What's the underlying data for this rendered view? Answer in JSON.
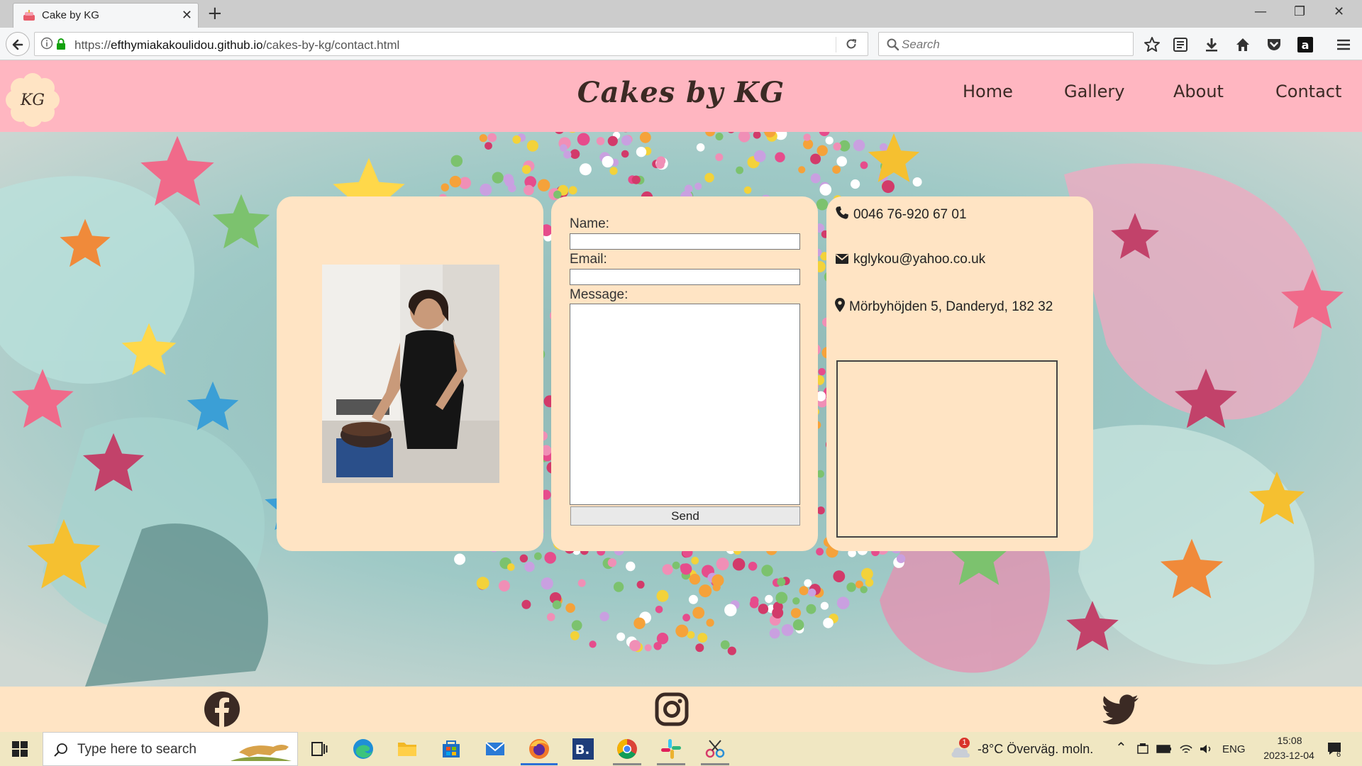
{
  "browser": {
    "tab_title": "Cake by KG",
    "new_tab": "+",
    "url_prefix": "https://",
    "url_host": "efthymiakakoulidou.github.io",
    "url_path": "/cakes-by-kg/contact.html",
    "search_placeholder": "Search",
    "window_controls": {
      "minimize": "—",
      "restore": "❐",
      "close": "✕"
    }
  },
  "site": {
    "logo": "KG",
    "title": "Cakes by KG",
    "nav": [
      "Home",
      "Gallery",
      "About",
      "Contact"
    ]
  },
  "contact_form": {
    "name_label": "Name:",
    "email_label": "Email:",
    "message_label": "Message:",
    "name_value": "",
    "email_value": "",
    "message_value": "",
    "send_label": "Send"
  },
  "contact_info": {
    "phone": "0046 76-920 67 01",
    "email": "kglykou@yahoo.co.uk",
    "address": "Mörbyhöjden 5, Danderyd, 182 32"
  },
  "footer": {
    "social": [
      "facebook-icon",
      "instagram-icon",
      "twitter-icon"
    ]
  },
  "taskbar": {
    "search_placeholder": "Type here to search",
    "weather": "-8°C  Överväg. moln.",
    "weather_badge": "1",
    "language": "ENG",
    "time": "15:08",
    "date": "2023-12-04",
    "notifications": "6"
  },
  "colors": {
    "header_pink": "#ffb6c1",
    "card_bisque": "#ffe4c4",
    "text_brown": "#3b2a24"
  }
}
